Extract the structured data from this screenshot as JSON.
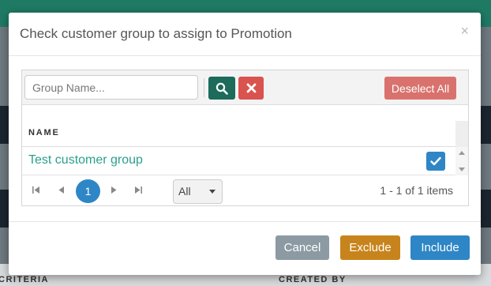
{
  "background": {
    "columns": [
      "CRITERIA",
      "CREATED BY"
    ]
  },
  "dialog": {
    "title": "Check customer group to assign to Promotion",
    "close_label": "×"
  },
  "toolbar": {
    "search_placeholder": "Group Name...",
    "search_value": "",
    "deselect_all_label": "Deselect All"
  },
  "grid": {
    "columns": [
      "NAME"
    ],
    "rows": [
      {
        "name": "Test customer group",
        "checked": true
      }
    ]
  },
  "pager": {
    "current_page": "1",
    "page_size": "All",
    "info": "1 - 1 of 1 items"
  },
  "footer": {
    "cancel_label": "Cancel",
    "exclude_label": "Exclude",
    "include_label": "Include"
  },
  "colors": {
    "search_button": "#1d6b5a",
    "clear_button": "#d9534f",
    "deselect_button": "#d9726d",
    "primary": "#2e86c6",
    "exclude": "#c8841c",
    "cancel": "#8c9aa3",
    "link": "#2aa18a"
  }
}
